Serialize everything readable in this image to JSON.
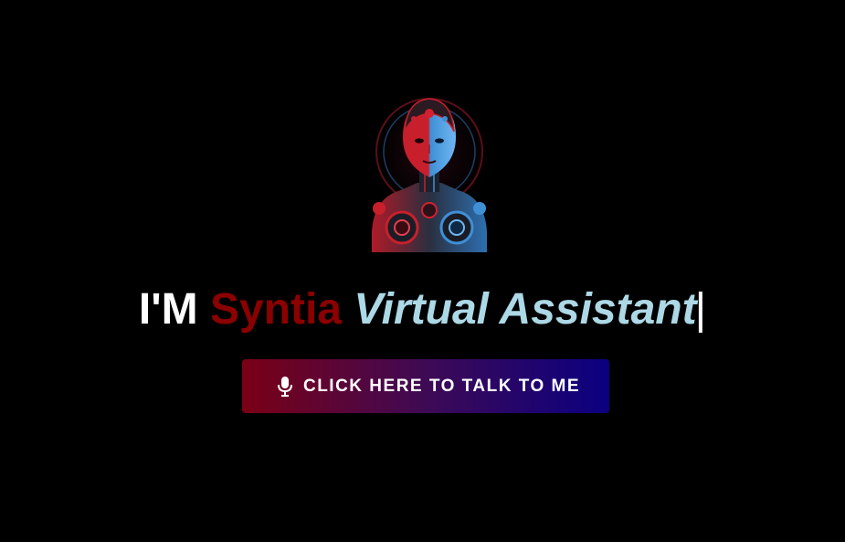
{
  "avatar": {
    "icon": "robot-woman-avatar",
    "colors": {
      "red": "#d4202e",
      "blue": "#3f8fd6"
    }
  },
  "headline": {
    "prefix": "I'M",
    "name": "Syntia",
    "role": "Virtual Assistant",
    "caret": "|",
    "colors": {
      "prefix": "#ffffff",
      "name": "#8b0000",
      "role": "#add8e6"
    }
  },
  "talk_button": {
    "label": "CLICK HERE TO TALK TO ME",
    "icon": "microphone-icon",
    "gradient": [
      "#7a0015",
      "#0b0080"
    ]
  }
}
